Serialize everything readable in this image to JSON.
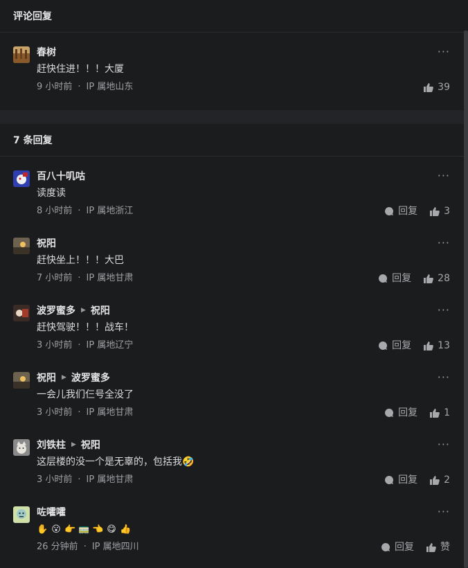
{
  "header": {
    "title": "评论回复"
  },
  "main_comment": {
    "user": "春树",
    "text": "赶快住进！！！大厦",
    "time": "9 小时前",
    "ip": "IP 属地山东",
    "likes": "39"
  },
  "replies_header": {
    "title": "7 条回复"
  },
  "reply_label": "回复",
  "more_glyph": "···",
  "dot_glyph": "·",
  "replies": [
    {
      "user": "百八十叽咕",
      "reply_to": "",
      "text": "读度读",
      "time": "8 小时前",
      "ip": "IP 属地浙江",
      "likes": "3"
    },
    {
      "user": "祝阳",
      "reply_to": "",
      "text": "赶快坐上！！！大巴",
      "time": "7 小时前",
      "ip": "IP 属地甘肃",
      "likes": "28"
    },
    {
      "user": "波罗蜜多",
      "reply_to": "祝阳",
      "text": "赶快驾驶！！！战车！",
      "time": "3 小时前",
      "ip": "IP 属地辽宁",
      "likes": "13"
    },
    {
      "user": "祝阳",
      "reply_to": "波罗蜜多",
      "text": "一会儿我们仨号全没了",
      "time": "3 小时前",
      "ip": "IP 属地甘肃",
      "likes": "1"
    },
    {
      "user": "刘铁柱",
      "reply_to": "祝阳",
      "text": "这层楼的没一个是无辜的，包括我🤣",
      "time": "3 小时前",
      "ip": "IP 属地甘肃",
      "likes": "2"
    },
    {
      "user": "咗嚯嚯",
      "reply_to": "",
      "text": "",
      "emojis": [
        "✋",
        "😮",
        "👉",
        "🚃",
        "👈",
        "😋",
        "👍"
      ],
      "time": "26 分钟前",
      "ip": "IP 属地四川",
      "likes": "赞"
    }
  ]
}
